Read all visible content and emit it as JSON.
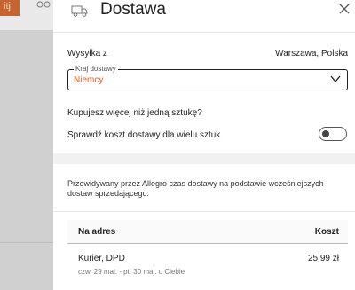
{
  "background": {
    "badge_text": "itj"
  },
  "drawer": {
    "title": "Dostawa",
    "icon_truck": "truck-icon",
    "icon_close": "close-icon",
    "from": {
      "label": "Wysyłka z",
      "value": "Warszawa, Polska"
    },
    "country_select": {
      "legend": "Kraj dostawy",
      "value": "Niemcy"
    },
    "question": "Kupujesz więcej niż jedną sztukę?",
    "toggle_label": "Sprawdź koszt dostawy dla wielu sztuk",
    "info": "Przewidywany przez Allegro czas dostawy na podstawie wcześniejszych dostaw sprzedającego.",
    "table": {
      "headers": {
        "address": "Na adres",
        "cost": "Koszt"
      },
      "rows": [
        {
          "carrier": "Kurier, DPD",
          "eta": "czw. 29 maj. - pt. 30 maj. u Ciebie",
          "price": "25,99 zł"
        }
      ]
    }
  },
  "colors": {
    "accent": "#e35a1c"
  }
}
